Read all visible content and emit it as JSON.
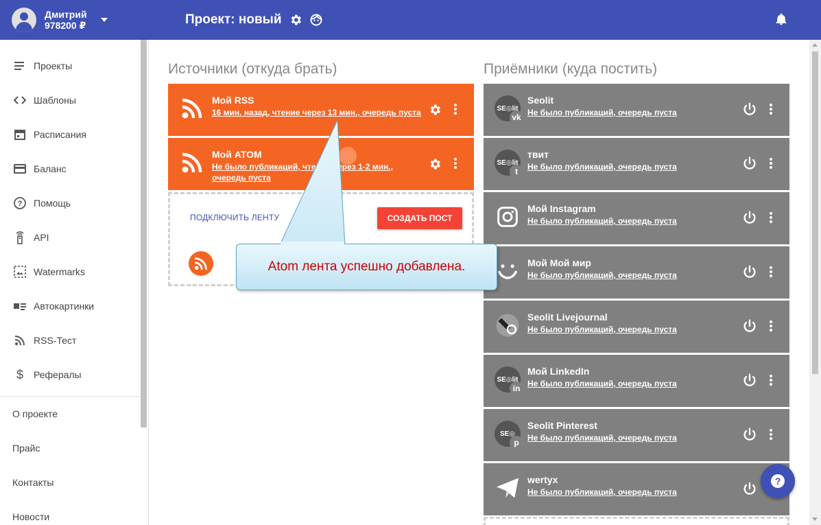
{
  "user": {
    "name": "Дмитрий",
    "balance": "978200 ₽"
  },
  "header": {
    "project_title": "Проект: новый"
  },
  "sidebar": {
    "items": [
      {
        "label": "Проекты",
        "icon": "list-icon"
      },
      {
        "label": "Шаблоны",
        "icon": "code-icon"
      },
      {
        "label": "Расписания",
        "icon": "calendar-icon"
      },
      {
        "label": "Баланс",
        "icon": "credit-card-icon"
      },
      {
        "label": "Помощь",
        "icon": "help-icon"
      },
      {
        "label": "API",
        "icon": "remote-icon"
      },
      {
        "label": "Watermarks",
        "icon": "watermark-icon"
      },
      {
        "label": "Автокартинки",
        "icon": "image-list-icon"
      },
      {
        "label": "RSS-Тест",
        "icon": "rss-icon"
      },
      {
        "label": "Рефералы",
        "icon": "dollar-icon"
      }
    ],
    "links": [
      "О проекте",
      "Прайс",
      "Контакты",
      "Новости"
    ]
  },
  "sources": {
    "title": "Источники (откуда брать)",
    "cards": [
      {
        "name": "Мой RSS",
        "status": "16 мин. назад, чтение через 13 мин., очередь пуста"
      },
      {
        "name": "Мой ATOM",
        "status": "Не было публикаций, чтение через 1-2 мин., очередь пуста"
      }
    ],
    "connect_label": "ПОДКЛЮЧИТЬ ЛЕНТУ",
    "create_label": "СОЗДАТЬ ПОСТ"
  },
  "receivers": {
    "title": "Приёмники (куда постить)",
    "cards": [
      {
        "name": "Seolit",
        "status": "Не было публикаций, очередь пуста",
        "icon": "vk-icon"
      },
      {
        "name": "твит",
        "status": "Не было публикаций, очередь пуста",
        "icon": "twitter-icon"
      },
      {
        "name": "Мой Instagram",
        "status": "Не было публикаций, очередь пуста",
        "icon": "instagram-icon"
      },
      {
        "name": "Мой Мой мир",
        "status": "Не было публикаций, очередь пуста",
        "icon": "moymir-icon"
      },
      {
        "name": "Seolit Livejournal",
        "status": "Не было публикаций, очередь пуста",
        "icon": "livejournal-icon"
      },
      {
        "name": "Мой LinkedIn",
        "status": "Не было публикаций, очередь пуста",
        "icon": "linkedin-icon"
      },
      {
        "name": "Seolit Pinterest",
        "status": "Не было публикаций, очередь пуста",
        "icon": "pinterest-icon"
      },
      {
        "name": "wertyx",
        "status": "Не было публикаций, очередь пуста",
        "icon": "telegram-icon"
      }
    ]
  },
  "tooltip": {
    "text": "Atom лента успешно добавлена."
  },
  "help": {
    "label": "?"
  },
  "colors": {
    "primary": "#3f51b5",
    "source_card": "#f46524",
    "receiver_card": "#808080",
    "create_button": "#f44336",
    "tooltip_text": "#cc0000"
  }
}
